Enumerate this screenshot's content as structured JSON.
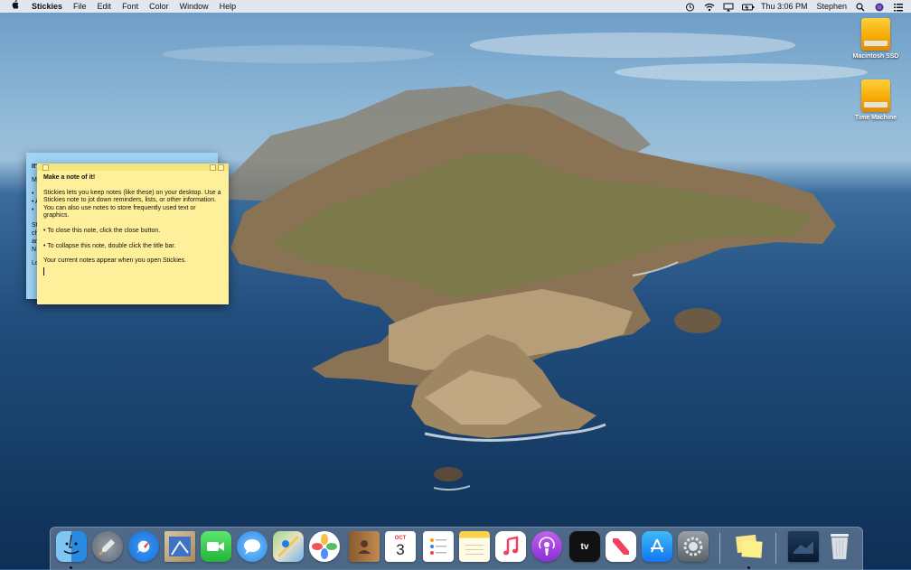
{
  "menubar": {
    "apple": "",
    "app_name": "Stickies",
    "menus": [
      "File",
      "Edit",
      "Font",
      "Color",
      "Window",
      "Help"
    ],
    "clock": "Thu 3:06 PM",
    "user": "Stephen"
  },
  "desktop": {
    "drives": [
      {
        "label": "Macintosh SSD"
      },
      {
        "label": "Time Machine"
      }
    ]
  },
  "stickies": {
    "back_note": {
      "color": "#9fd4f7",
      "lines": [
        "It's",
        "M",
        "",
        "• ",
        "• A",
        "• ",
        "",
        "St",
        "ch",
        "ar",
        "N",
        "",
        "Lo"
      ]
    },
    "front_note": {
      "color": "#fef09a",
      "title": "Make a note of it!",
      "para1": "Stickies lets you keep notes (like these) on your desktop. Use a Stickies note to jot down reminders, lists, or other information. You can also use notes to store frequently used text or graphics.",
      "para2": "• To close this note, click the close button.",
      "para3": "• To collapse this note, double click the title bar.",
      "para4": "Your current notes appear when you open Stickies."
    }
  },
  "dock": {
    "items": [
      {
        "name": "Finder",
        "icon": "finder-icon",
        "running": true
      },
      {
        "name": "Launchpad",
        "icon": "launchpad-icon",
        "running": false
      },
      {
        "name": "Safari",
        "icon": "safari-icon",
        "running": false
      },
      {
        "name": "Mail",
        "icon": "mail-icon",
        "running": false
      },
      {
        "name": "FaceTime",
        "icon": "facetime-icon",
        "running": false
      },
      {
        "name": "Messages",
        "icon": "messages-icon",
        "running": false
      },
      {
        "name": "Maps",
        "icon": "maps-icon",
        "running": false
      },
      {
        "name": "Photos",
        "icon": "photos-icon",
        "running": false
      },
      {
        "name": "Contacts",
        "icon": "contacts-icon",
        "running": false
      },
      {
        "name": "Calendar",
        "icon": "calendar-icon",
        "running": false,
        "month": "OCT",
        "day": "3"
      },
      {
        "name": "Reminders",
        "icon": "reminders-icon",
        "running": false
      },
      {
        "name": "Notes",
        "icon": "notes-icon",
        "running": false
      },
      {
        "name": "Music",
        "icon": "music-icon",
        "running": false
      },
      {
        "name": "Podcasts",
        "icon": "podcasts-icon",
        "running": false
      },
      {
        "name": "TV",
        "icon": "tv-icon",
        "running": false,
        "glyph": "tv"
      },
      {
        "name": "News",
        "icon": "news-icon",
        "running": false
      },
      {
        "name": "App Store",
        "icon": "app-store-icon",
        "running": false
      },
      {
        "name": "System Preferences",
        "icon": "system-preferences-icon",
        "running": false
      },
      {
        "name": "Stickies",
        "icon": "stickies-icon",
        "running": true
      },
      {
        "name": "Desktop Folder",
        "icon": "desktop-stack-icon",
        "running": false
      },
      {
        "name": "Trash",
        "icon": "trash-icon",
        "running": false
      }
    ]
  }
}
